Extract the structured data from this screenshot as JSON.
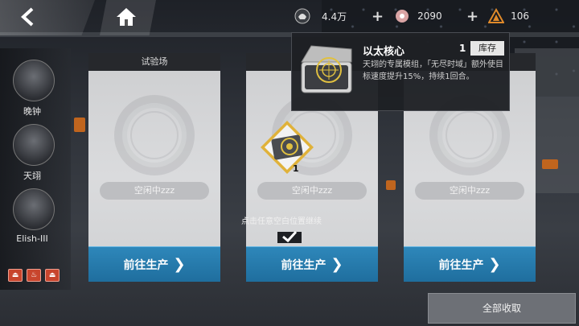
{
  "topbar": {
    "back_icon": "back-arrow-icon",
    "home_icon": "home-icon",
    "resources": [
      {
        "icon": "helmet-icon",
        "value": "4.4万"
      },
      {
        "icon": "flower-icon",
        "value": "2090"
      },
      {
        "icon": "pyramid-icon",
        "value": "106"
      }
    ]
  },
  "characters": [
    {
      "name": "晚钟"
    },
    {
      "name": "天翊"
    },
    {
      "name": "Elish-III"
    }
  ],
  "slots": [
    {
      "title": "试验场",
      "status": "空闲中zzz",
      "button": "前往生产"
    },
    {
      "title": "",
      "status": "空闲中zzz",
      "button": "前往生产"
    },
    {
      "title": "",
      "status": "空闲中zzz",
      "button": "前往生产"
    }
  ],
  "item_drop": {
    "count": "1"
  },
  "tooltip": {
    "title": "以太核心",
    "count": "1",
    "store_label": "库存",
    "description": "天翊的专属模组，「无尽时域」额外使目标速度提升15%，持续1回合。"
  },
  "hint": "点击任意空白位置继续",
  "collect_all": "全部收取",
  "colors": {
    "accent_blue": "#2e87ba",
    "warning_red": "#c8452d",
    "gold": "#e0b23a"
  }
}
